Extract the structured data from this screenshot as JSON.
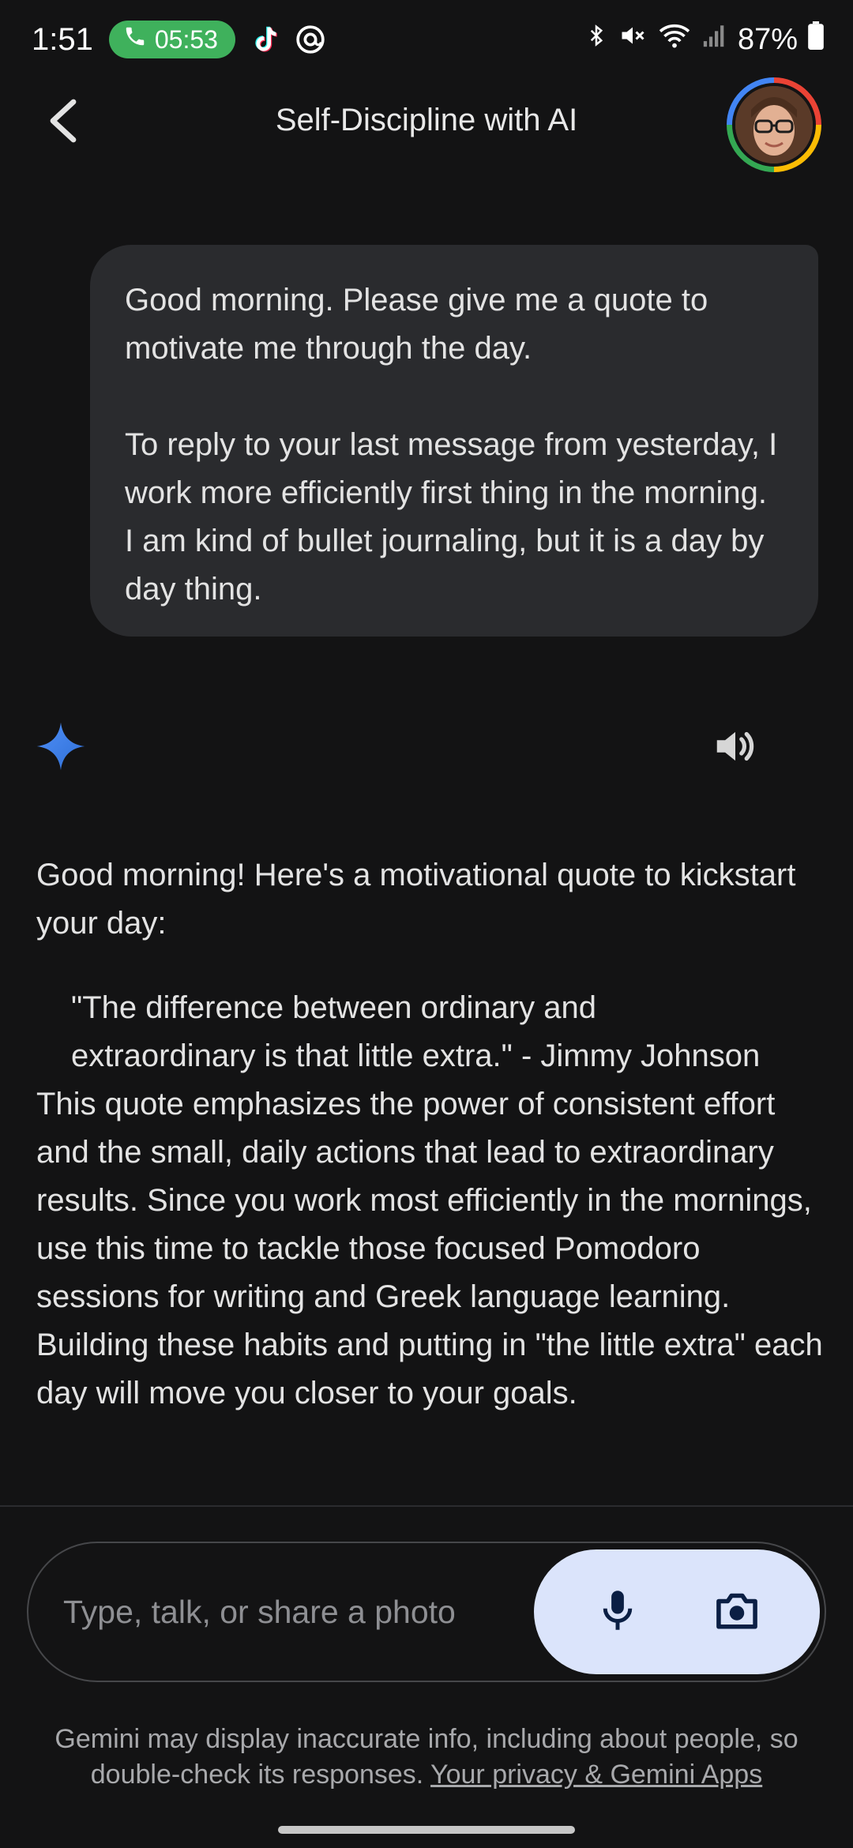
{
  "status_bar": {
    "time": "1:51",
    "call_timer": "05:53",
    "battery_percent": "87%",
    "icons": [
      "phone-icon",
      "tiktok-icon",
      "threads-icon",
      "bluetooth-icon",
      "mute-icon",
      "wifi-icon",
      "signal-icon",
      "battery-icon"
    ]
  },
  "header": {
    "title": "Self-Discipline with AI"
  },
  "conversation": {
    "user_message": {
      "paragraph_1": "Good morning. Please give me a quote to motivate me through the day.",
      "paragraph_2": "To reply to your last message from yesterday, I work more efficiently first thing in the morning. I am kind of bullet journaling, but it is a day by day thing."
    },
    "assistant_message": {
      "intro": "Good morning! Here's a motivational quote to kickstart your day:",
      "quote_line_1": "\"The difference between ordinary and",
      "quote_line_2": "extraordinary is that little extra.\" - Jimmy Johnson",
      "body": "This quote emphasizes the power of consistent effort and the small, daily actions that lead to extraordinary results.  Since you work most efficiently in the mornings, use this time to tackle those focused Pomodoro sessions for writing and Greek language learning.  Building these habits and putting in \"the little extra\" each day will move you closer to your goals."
    }
  },
  "input": {
    "placeholder": "Type, talk, or share a photo"
  },
  "footer": {
    "disclaimer": "Gemini may display inaccurate info, including about people, so double-check its responses. ",
    "privacy_link": "Your privacy & Gemini Apps"
  },
  "colors": {
    "background": "#131314",
    "bubble": "#2a2b2e",
    "accent_sparkle": "#4a90e2",
    "action_pill": "#dbe4fb",
    "call_pill": "#3fb15c"
  }
}
